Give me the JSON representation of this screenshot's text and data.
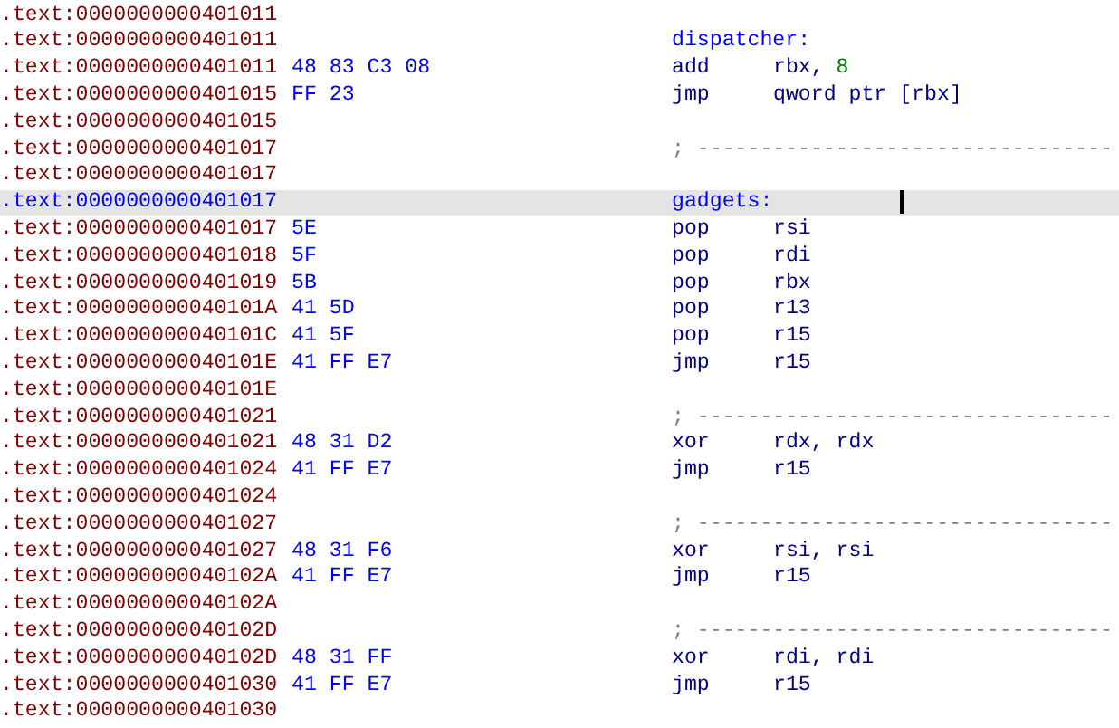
{
  "listing": [
    {
      "address": ".text:0000000000401011",
      "selected": false,
      "kind": "blank"
    },
    {
      "address": ".text:0000000000401011",
      "selected": false,
      "kind": "label",
      "label": "dispatcher:"
    },
    {
      "address": ".text:0000000000401011",
      "selected": false,
      "kind": "instr",
      "bytes": "48 83 C3 08",
      "mnemonic": "add",
      "operands": [
        {
          "text": "rbx, ",
          "kind": "reg"
        },
        {
          "text": "8",
          "kind": "num"
        }
      ]
    },
    {
      "address": ".text:0000000000401015",
      "selected": false,
      "kind": "instr",
      "bytes": "FF 23",
      "mnemonic": "jmp",
      "operands": [
        {
          "text": "qword ptr [rbx]",
          "kind": "reg"
        }
      ]
    },
    {
      "address": ".text:0000000000401015",
      "selected": false,
      "kind": "blank"
    },
    {
      "address": ".text:0000000000401017",
      "selected": false,
      "kind": "separator",
      "comment": "; ---------------------------------"
    },
    {
      "address": ".text:0000000000401017",
      "selected": false,
      "kind": "blank"
    },
    {
      "address": ".text:0000000000401017",
      "selected": true,
      "kind": "label",
      "label": "gadgets:"
    },
    {
      "address": ".text:0000000000401017",
      "selected": false,
      "kind": "instr",
      "bytes": "5E",
      "mnemonic": "pop",
      "operands": [
        {
          "text": "rsi",
          "kind": "reg"
        }
      ]
    },
    {
      "address": ".text:0000000000401018",
      "selected": false,
      "kind": "instr",
      "bytes": "5F",
      "mnemonic": "pop",
      "operands": [
        {
          "text": "rdi",
          "kind": "reg"
        }
      ]
    },
    {
      "address": ".text:0000000000401019",
      "selected": false,
      "kind": "instr",
      "bytes": "5B",
      "mnemonic": "pop",
      "operands": [
        {
          "text": "rbx",
          "kind": "reg"
        }
      ]
    },
    {
      "address": ".text:000000000040101A",
      "selected": false,
      "kind": "instr",
      "bytes": "41 5D",
      "mnemonic": "pop",
      "operands": [
        {
          "text": "r13",
          "kind": "reg"
        }
      ]
    },
    {
      "address": ".text:000000000040101C",
      "selected": false,
      "kind": "instr",
      "bytes": "41 5F",
      "mnemonic": "pop",
      "operands": [
        {
          "text": "r15",
          "kind": "reg"
        }
      ]
    },
    {
      "address": ".text:000000000040101E",
      "selected": false,
      "kind": "instr",
      "bytes": "41 FF E7",
      "mnemonic": "jmp",
      "operands": [
        {
          "text": "r15",
          "kind": "reg"
        }
      ]
    },
    {
      "address": ".text:000000000040101E",
      "selected": false,
      "kind": "blank"
    },
    {
      "address": ".text:0000000000401021",
      "selected": false,
      "kind": "separator",
      "comment": "; ---------------------------------"
    },
    {
      "address": ".text:0000000000401021",
      "selected": false,
      "kind": "instr",
      "bytes": "48 31 D2",
      "mnemonic": "xor",
      "operands": [
        {
          "text": "rdx, rdx",
          "kind": "reg"
        }
      ]
    },
    {
      "address": ".text:0000000000401024",
      "selected": false,
      "kind": "instr",
      "bytes": "41 FF E7",
      "mnemonic": "jmp",
      "operands": [
        {
          "text": "r15",
          "kind": "reg"
        }
      ]
    },
    {
      "address": ".text:0000000000401024",
      "selected": false,
      "kind": "blank"
    },
    {
      "address": ".text:0000000000401027",
      "selected": false,
      "kind": "separator",
      "comment": "; ---------------------------------"
    },
    {
      "address": ".text:0000000000401027",
      "selected": false,
      "kind": "instr",
      "bytes": "48 31 F6",
      "mnemonic": "xor",
      "operands": [
        {
          "text": "rsi, rsi",
          "kind": "reg"
        }
      ]
    },
    {
      "address": ".text:000000000040102A",
      "selected": false,
      "kind": "instr",
      "bytes": "41 FF E7",
      "mnemonic": "jmp",
      "operands": [
        {
          "text": "r15",
          "kind": "reg"
        }
      ]
    },
    {
      "address": ".text:000000000040102A",
      "selected": false,
      "kind": "blank"
    },
    {
      "address": ".text:000000000040102D",
      "selected": false,
      "kind": "separator",
      "comment": "; ---------------------------------"
    },
    {
      "address": ".text:000000000040102D",
      "selected": false,
      "kind": "instr",
      "bytes": "48 31 FF",
      "mnemonic": "xor",
      "operands": [
        {
          "text": "rdi, rdi",
          "kind": "reg"
        }
      ]
    },
    {
      "address": ".text:0000000000401030",
      "selected": false,
      "kind": "instr",
      "bytes": "41 FF E7",
      "mnemonic": "jmp",
      "operands": [
        {
          "text": "r15",
          "kind": "reg"
        }
      ]
    },
    {
      "address": ".text:0000000000401030",
      "selected": false,
      "kind": "blank"
    }
  ]
}
